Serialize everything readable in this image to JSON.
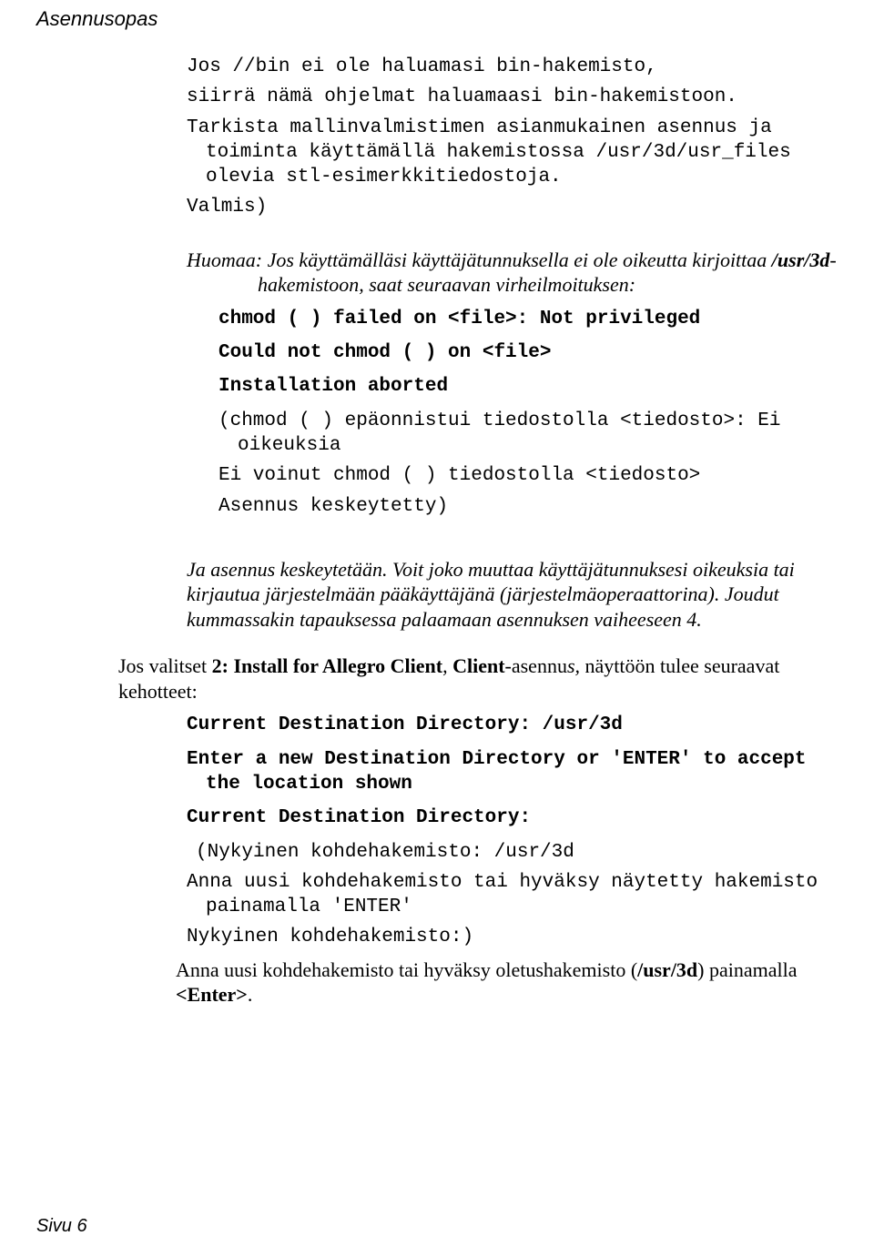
{
  "header": {
    "title": "Asennusopas"
  },
  "block1": {
    "p1a": "Jos //bin ei ole haluamasi bin-hakemisto,",
    "p1b": "siirrä nämä ohjelmat haluamaasi bin-hakemistoon.",
    "p2": "Tarkista mallinvalmistimen asianmukainen asennus ja toiminta käyttämällä hakemistossa /usr/3d/usr_files olevia stl-esimerkkitiedostoja.",
    "p3": "Valmis)"
  },
  "note1": {
    "label": "Huomaa:",
    "text": " Jos käyttämälläsi käyttäjätunnuksella ei ole oikeutta kirjoittaa /usr/3d-hakemistoon, saat seuraavan virheilmoituksen:"
  },
  "errblock": {
    "l1": "chmod ( ) failed on <file>: Not privileged",
    "l2": "Could not chmod ( ) on <file>",
    "l3": "Installation aborted",
    "t1": "(chmod ( ) epäonnistui tiedostolla <tiedosto>: Ei oikeuksia",
    "t2": "Ei voinut chmod ( ) tiedostolla <tiedosto>",
    "t3": "Asennus keskeytetty)"
  },
  "note2": {
    "text": "Ja asennus keskeytetään. Voit joko muuttaa käyttäjätunnuksesi oikeuksia tai kirjautua järjestelmään pääkäyttäjänä (järjestelmäoperaattorina). Joudut kummassakin tapauksessa palaamaan asennuksen vaiheeseen 4."
  },
  "para2": {
    "pre": "Jos valitset ",
    "bold1": "2: Install for Allegro Client",
    "mid1": ", ",
    "bold2": "Client",
    "mid2": "-asennu",
    "ital": "s,",
    "post": " näyttöön tulee seuraavat kehotteet:"
  },
  "destblock": {
    "l1": "Current Destination Directory: /usr/3d",
    "l2": "Enter a new Destination Directory or 'ENTER' to accept the location shown",
    "l3": "Current Destination Directory:",
    "t1": "(Nykyinen kohdehakemisto: /usr/3d",
    "t2": "Anna uusi kohdehakemisto tai hyväksy näytetty hakemisto painamalla 'ENTER'",
    "t3": "Nykyinen kohdehakemisto:)"
  },
  "finalpara": {
    "pre": "Anna uusi kohdehakemisto tai hyväksy oletushakemisto (",
    "bold1": "/usr/3d",
    "mid": ") painamalla ",
    "bold2": "<Enter>",
    "post": "."
  },
  "footer": {
    "text": "Sivu 6"
  }
}
